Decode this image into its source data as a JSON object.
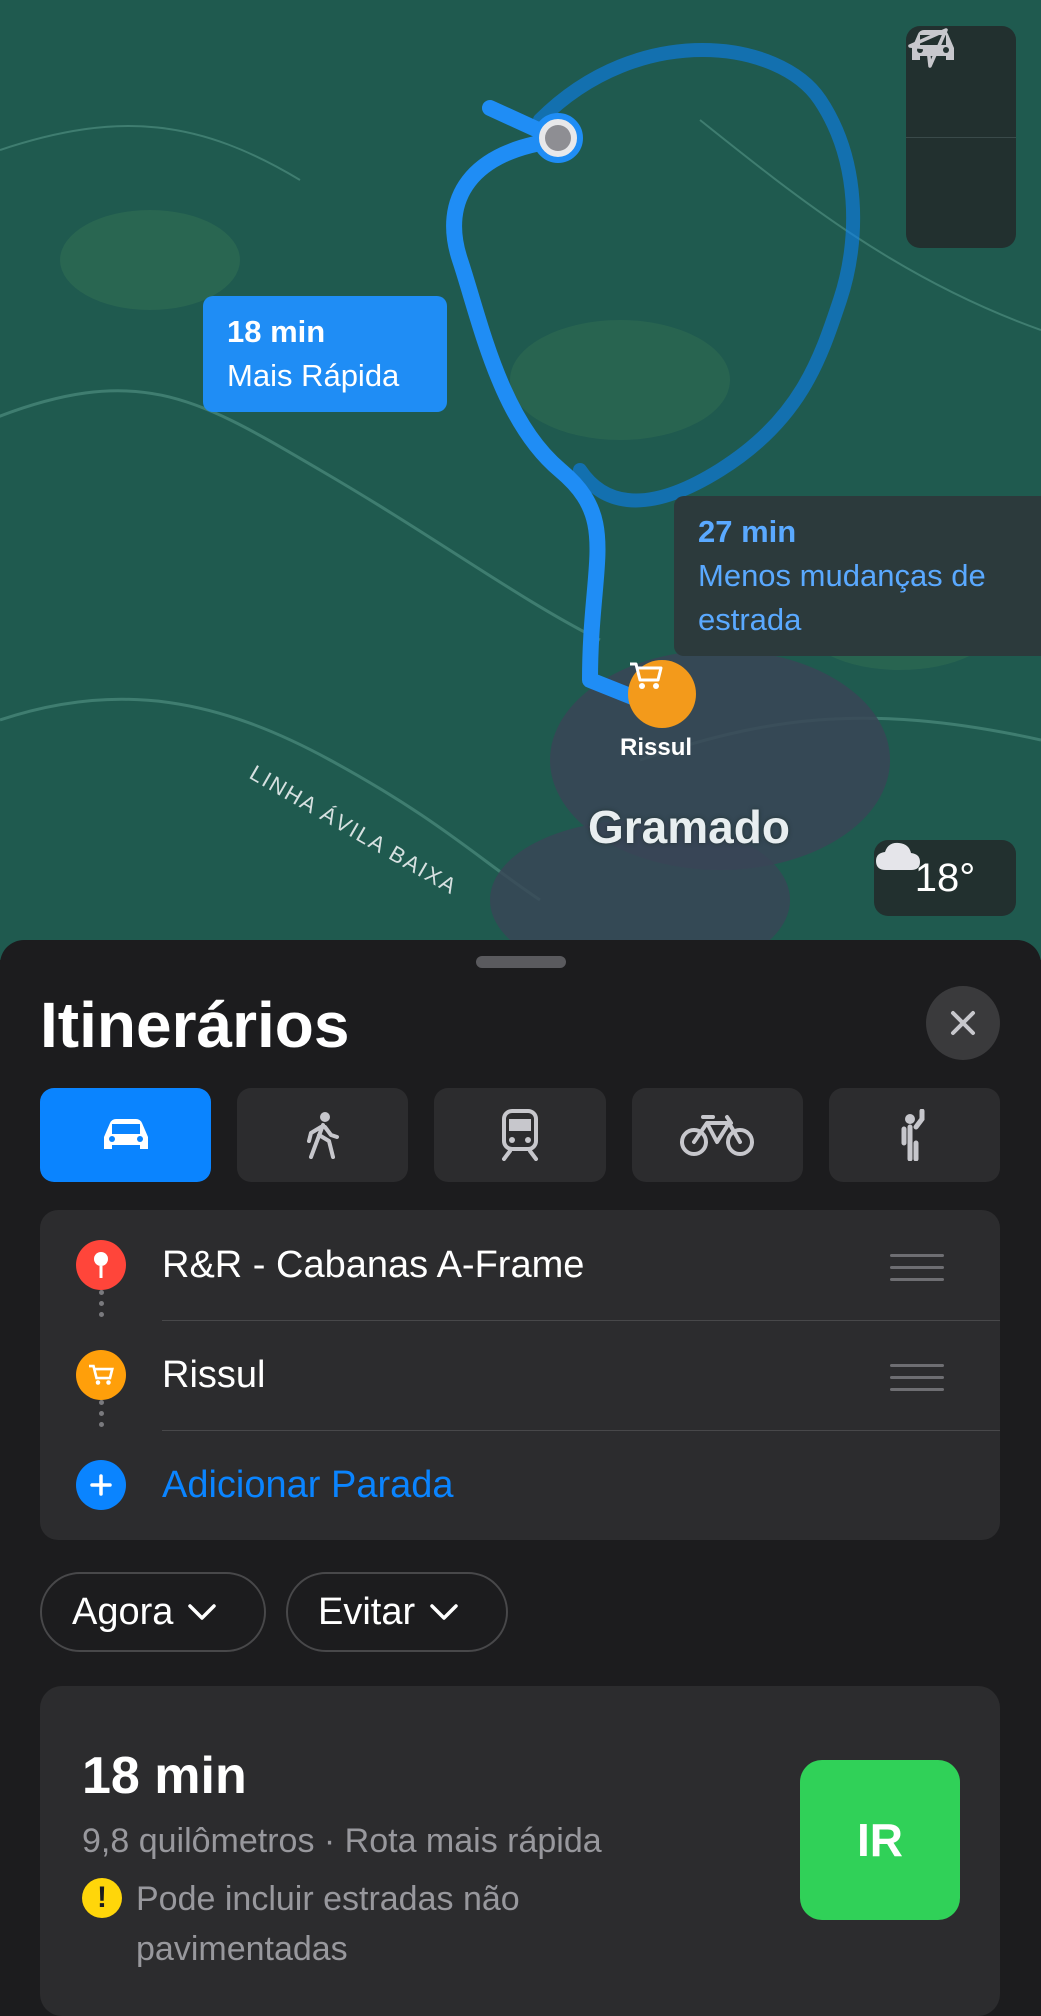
{
  "map": {
    "route_primary": {
      "time": "18 min",
      "label": "Mais Rápida"
    },
    "route_secondary": {
      "time": "27 min",
      "label": "Menos mudanças de estrada"
    },
    "city": "Gramado",
    "poi": {
      "name": "Rissul",
      "icon": "cart-icon"
    },
    "road_name": "LINHA ÁVILA BAIXA",
    "weather": {
      "temp": "18°",
      "icon": "cloud-icon"
    },
    "controls": [
      "car-icon",
      "location-arrow-icon"
    ]
  },
  "sheet": {
    "title": "Itinerários",
    "modes": [
      {
        "name": "drive",
        "icon": "car-icon",
        "active": true
      },
      {
        "name": "walk",
        "icon": "walking-icon",
        "active": false
      },
      {
        "name": "transit",
        "icon": "train-icon",
        "active": false
      },
      {
        "name": "bike",
        "icon": "bicycle-icon",
        "active": false
      },
      {
        "name": "ride",
        "icon": "hail-icon",
        "active": false
      }
    ],
    "stops": [
      {
        "label": "R&R - Cabanas A-Frame",
        "color": "#ff453a"
      },
      {
        "label": "Rissul",
        "color": "#ff9f0a"
      }
    ],
    "add_stop": "Adicionar Parada",
    "filters": {
      "time": "Agora",
      "avoid": "Evitar"
    },
    "route": {
      "time": "18 min",
      "details": "9,8 quilômetros · Rota mais rápida",
      "warning": "Pode incluir estradas não pavimentadas",
      "go": "IR"
    }
  },
  "colors": {
    "accent": "#0a84ff",
    "go": "#30d158",
    "warning": "#ffd60a"
  }
}
